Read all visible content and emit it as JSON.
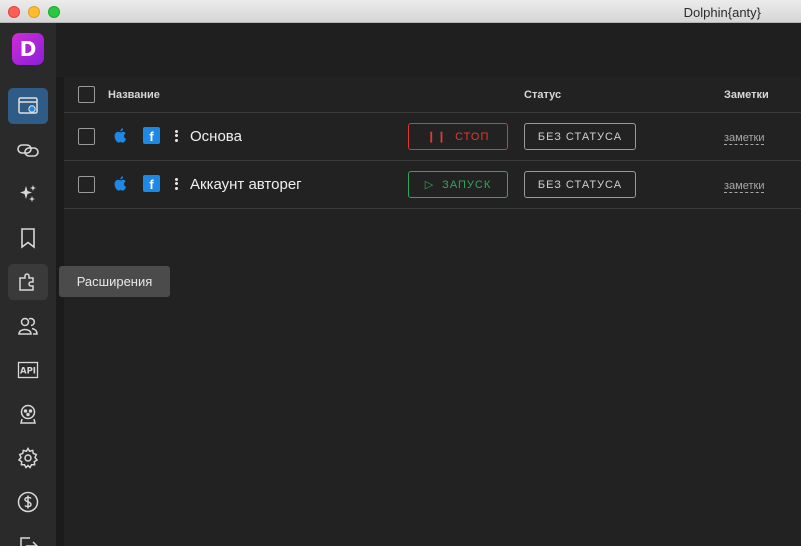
{
  "window": {
    "title": "Dolphin{anty}"
  },
  "sidebar": {
    "logo_letter": "D",
    "items": [
      {
        "name": "browser-profiles",
        "icon": "browser-window-icon",
        "active": true
      },
      {
        "name": "proxies",
        "icon": "link-icon"
      },
      {
        "name": "automation",
        "icon": "sparkles-icon"
      },
      {
        "name": "bookmarks",
        "icon": "bookmark-icon"
      },
      {
        "name": "extensions",
        "icon": "puzzle-icon"
      },
      {
        "name": "users",
        "icon": "users-icon"
      },
      {
        "name": "api",
        "icon": "api-icon",
        "label": "API"
      },
      {
        "name": "team",
        "icon": "team-icon"
      },
      {
        "name": "settings",
        "icon": "gear-icon"
      },
      {
        "name": "billing",
        "icon": "dollar-icon"
      },
      {
        "name": "logout",
        "icon": "logout-icon"
      }
    ]
  },
  "tooltip": {
    "text": "Расширения"
  },
  "table": {
    "columns": {
      "name": "Название",
      "status": "Статус",
      "notes": "Заметки"
    },
    "rows": [
      {
        "name": "Основа",
        "action": "СТОП",
        "action_type": "stop",
        "status": "БЕЗ СТАТУСА",
        "notes": "заметки"
      },
      {
        "name": "Аккаунт авторег",
        "action": "ЗАПУСК",
        "action_type": "start",
        "status": "БЕЗ СТАТУСА",
        "notes": "заметки"
      }
    ]
  },
  "colors": {
    "accent": "#2f5c86",
    "stop": "#e0392f",
    "start": "#2ea85a",
    "facebook": "#1e88e5",
    "logo": "#c027d6"
  }
}
